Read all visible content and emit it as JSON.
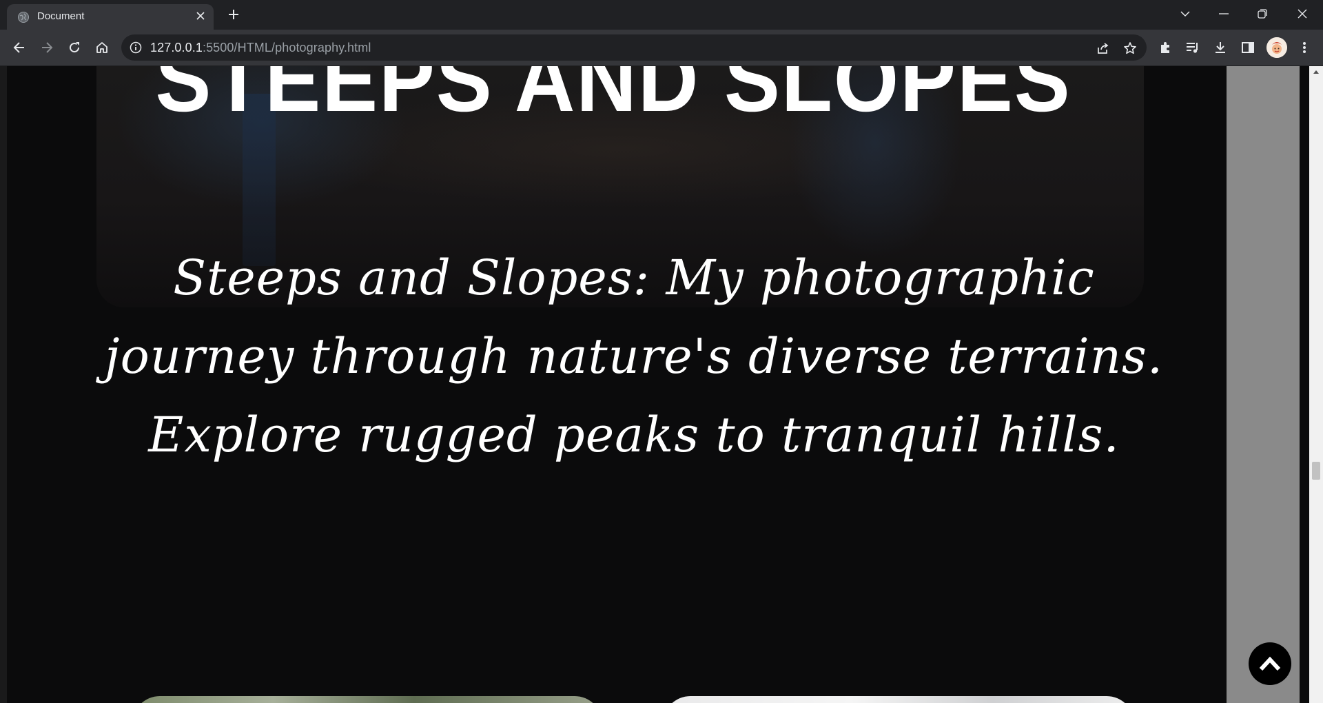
{
  "browser": {
    "tab": {
      "title": "Document",
      "favicon": "globe-icon"
    },
    "url": {
      "host": "127.0.0.1",
      "rest": ":5500/HTML/photography.html"
    },
    "window_controls": [
      "chevron-down-icon",
      "minimize-icon",
      "restore-icon",
      "close-icon"
    ],
    "toolbar_icons": [
      "share-icon",
      "star-icon",
      "extensions-icon",
      "media-icon",
      "download-icon",
      "sidepanel-icon",
      "avatar",
      "menu-icon"
    ]
  },
  "page": {
    "hero_title": "STEEPS AND SLOPES",
    "tagline": "Steeps and Slopes: My photographic journey through nature's diverse terrains. Explore rugged peaks to tranquil hills.",
    "scroll_top_icon": "chevron-up-icon"
  },
  "colors": {
    "page_background": "#0b0b0c",
    "text": "#ffffff",
    "chrome_dark": "#202124",
    "chrome_toolbar": "#35363a",
    "side_panel": "#8a8a8a"
  }
}
